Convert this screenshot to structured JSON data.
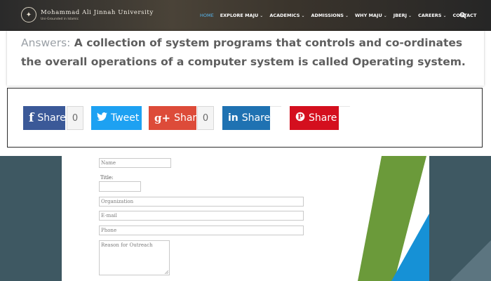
{
  "header": {
    "university_name": "Mohammad Ali Jinnah University",
    "tagline": "Uni-Grounded in Islamic",
    "nav": [
      {
        "label": "HOME",
        "active": true,
        "has_dropdown": false
      },
      {
        "label": "EXPLORE MAJU",
        "active": false,
        "has_dropdown": true
      },
      {
        "label": "ACADEMICS",
        "active": false,
        "has_dropdown": true
      },
      {
        "label": "ADMISSIONS",
        "active": false,
        "has_dropdown": true
      },
      {
        "label": "WHY MAJU",
        "active": false,
        "has_dropdown": true
      },
      {
        "label": "JBERJ",
        "active": false,
        "has_dropdown": true
      },
      {
        "label": "CAREERS",
        "active": false,
        "has_dropdown": true
      },
      {
        "label": "CONTACT",
        "active": false,
        "has_dropdown": false
      }
    ],
    "caret": "⌄",
    "search_icon": "search-icon"
  },
  "answer": {
    "label": "Answers:",
    "text": "A collection of system programs that controls and co-ordinates the overall operations of a computer system is called Operating system."
  },
  "share": {
    "facebook": {
      "icon": "f",
      "label": "Share",
      "count": "0",
      "color": "#3b5998"
    },
    "twitter": {
      "icon": "🐦",
      "label": "Tweet",
      "color": "#1da1f2"
    },
    "googleplus": {
      "icon": "g+",
      "label": "Share",
      "count": "0",
      "color": "#dd4b39"
    },
    "linkedin": {
      "icon": "in",
      "label": "Share",
      "color": "#1f72b2"
    },
    "pinterest": {
      "icon": "P",
      "label": "Share",
      "color": "#d40f1e"
    }
  },
  "form": {
    "name_placeholder": "Name",
    "title_label": "Title:",
    "organization_placeholder": "Organization",
    "email_placeholder": "E-mail",
    "phone_placeholder": "Phone",
    "reason_placeholder": "Reason for Outreach"
  },
  "colors": {
    "accent_green": "#6b9a3a",
    "accent_blue": "#1691d6",
    "panel_slate": "#3e5862"
  }
}
